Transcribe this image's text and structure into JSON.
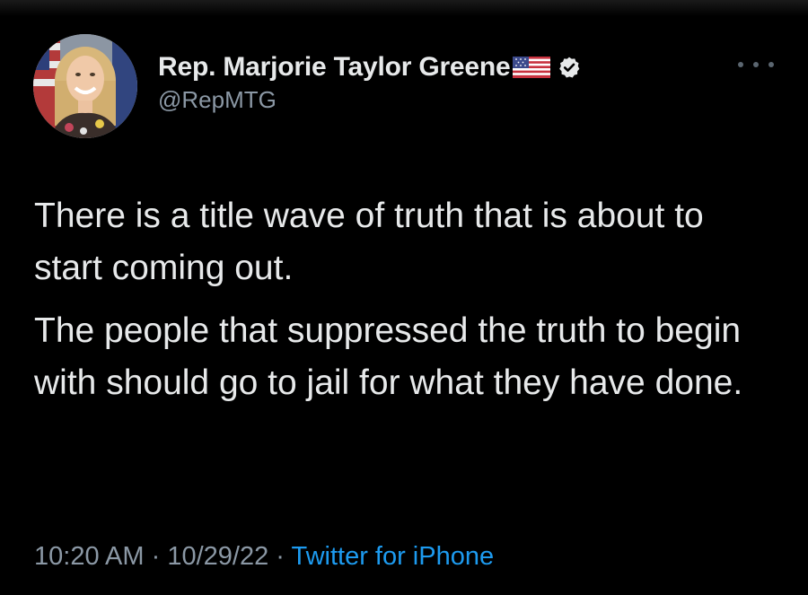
{
  "author": {
    "display_name": "Rep. Marjorie Taylor Greene",
    "handle": "@RepMTG",
    "avatar_icon": "profile-photo",
    "flag_icon": "us-flag-icon",
    "verified_icon": "verified-badge-icon"
  },
  "menu": {
    "icon": "more-options-icon"
  },
  "tweet": {
    "paragraph_1": "There is a title wave of truth that is about to start coming out.",
    "paragraph_2": "The people that suppressed the truth to begin with should go to jail for what they have done."
  },
  "meta": {
    "time": "10:20 AM",
    "separator_1": " · ",
    "date": "10/29/22",
    "separator_2": " · ",
    "source": "Twitter for iPhone"
  },
  "colors": {
    "background": "#000000",
    "text_primary": "#e7e9ea",
    "text_secondary": "#8b98a5",
    "link": "#1d9bf0",
    "verified": "#e7e9ea"
  }
}
